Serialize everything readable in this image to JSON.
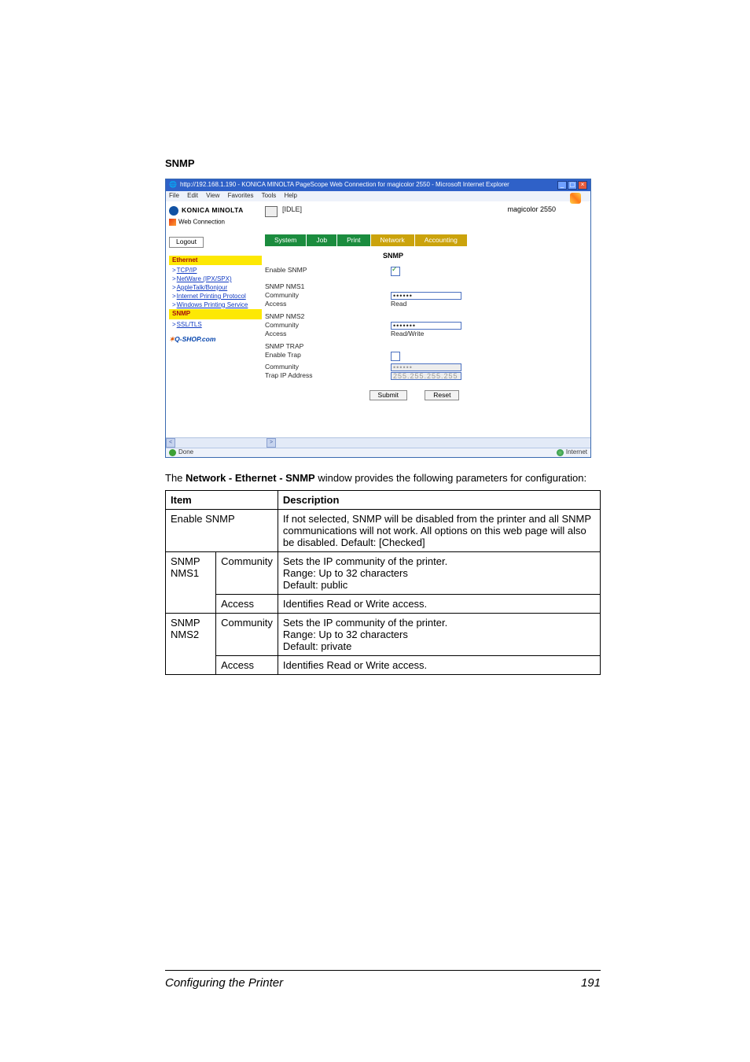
{
  "heading": "SNMP",
  "ie": {
    "title": "http://192.168.1.190 - KONICA MINOLTA PageScope Web Connection for magicolor 2550 - Microsoft Internet Explorer",
    "menu": [
      "File",
      "Edit",
      "View",
      "Favorites",
      "Tools",
      "Help"
    ],
    "brand": "KONICA MINOLTA",
    "app_name_prefix": "PAGE SCOPE ",
    "app_name": "Web Connection",
    "logout": "Logout",
    "status_text": "[IDLE]",
    "model": "magicolor 2550",
    "tabs": [
      "System",
      "Job",
      "Print",
      "Network",
      "Accounting"
    ],
    "nav_active1": "Ethernet",
    "nav_items1": [
      "TCP/IP",
      "NetWare (IPX/SPX)",
      "AppleTalk/Bonjour",
      "Internet Printing Protocol",
      "Windows Printing Service"
    ],
    "nav_active2": "SNMP",
    "nav_items2": [
      "SSL/TLS"
    ],
    "qshop": "Q-SHOP.com",
    "snmp_heading": "SNMP",
    "enable_snmp_label": "Enable SNMP",
    "grp1": "SNMP NMS1",
    "comm_lbl": "Community",
    "access_lbl": "Access",
    "nms1_access": "Read",
    "grp2": "SNMP NMS2",
    "nms2_access": "Read/Write",
    "grp3": "SNMP TRAP",
    "enable_trap": "Enable Trap",
    "trap_ip_lbl": "Trap IP Address",
    "trap_ip_val": "255.255.255.255",
    "submit": "Submit",
    "reset": "Reset",
    "pw_dots6": "••••••",
    "pw_dots7": "•••••••",
    "done": "Done",
    "zone": "Internet"
  },
  "explain_pre": "The ",
  "explain_bold": "Network - Ethernet - SNMP",
  "explain_post": " window provides the following parameters for configuration:",
  "table": {
    "h_item": "Item",
    "h_desc": "Description",
    "r1c1": "Enable SNMP",
    "r1c2": "If not selected, SNMP will be disabled from the printer and all SNMP communications will not work. All options on this web page will also be disabled. Default: [Checked]",
    "r2a": "SNMP NMS1",
    "r2b": "Community",
    "r2c": "Sets the IP community of the printer.\nRange: Up to 32 characters\nDefault: public",
    "r3b": "Access",
    "r3c": "Identifies Read or Write access.",
    "r4a": "SNMP NMS2",
    "r4b": "Community",
    "r4c": "Sets the IP community of the printer.\nRange: Up to 32 characters\nDefault: private",
    "r5b": "Access",
    "r5c": "Identifies Read or Write access."
  },
  "footer_title": "Configuring the Printer",
  "footer_page": "191"
}
